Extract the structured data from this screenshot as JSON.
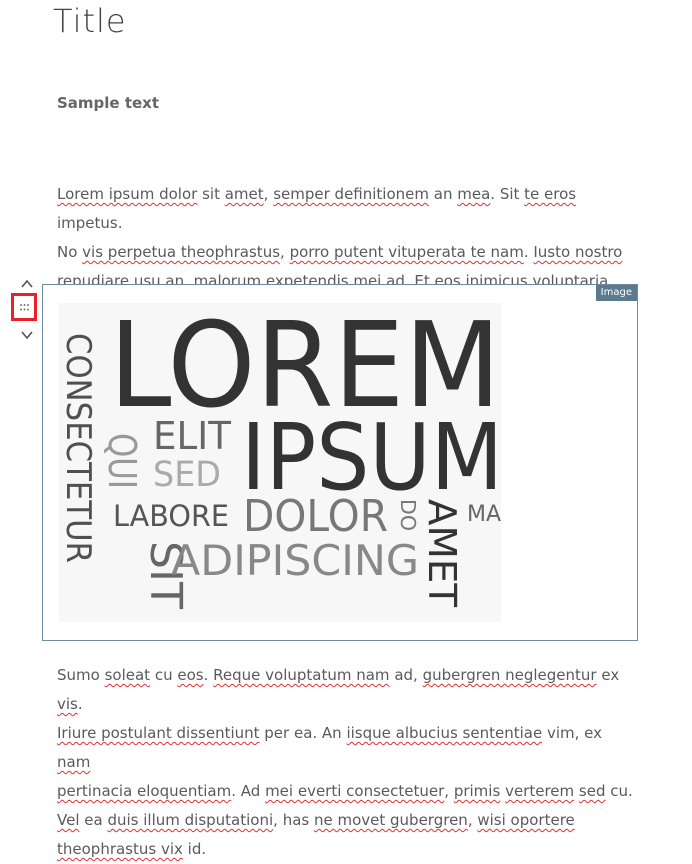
{
  "page": {
    "title": "Title",
    "subtitle": "Sample text"
  },
  "paragraph1": {
    "lines": [
      [
        "Lorem ipsum dolor",
        " sit ",
        "amet",
        ", ",
        "semper definitionem",
        " an ",
        "mea",
        ". Sit ",
        "te eros",
        " impetus."
      ],
      [
        "No ",
        "vis perpetua theophrastus",
        ", ",
        "porro putent vituperata te nam",
        ". ",
        "Iusto nostro"
      ],
      [
        "repudiare",
        " usu an, ",
        "malorum expetendis mei",
        " ad. ",
        "Et eos inimicus voluptaria",
        "."
      ]
    ]
  },
  "block_tools": {
    "move_up": "move-up",
    "drag": "drag-handle",
    "move_down": "move-down"
  },
  "image_block": {
    "badge": "Image",
    "words": [
      "LOREM",
      "IPSUM",
      "CONSECTETUR",
      "QUI",
      "ELIT",
      "SED",
      "LABORE",
      "DOLOR",
      "DO",
      "AMET",
      "MA",
      "SIT",
      "ADIPISCING"
    ]
  },
  "paragraph2": {
    "lines": [
      [
        "Sumo ",
        "soleat",
        " cu ",
        "eos",
        ". ",
        "Reque voluptatum nam",
        " ad, ",
        "gubergren neglegentur",
        " ex  ",
        "vis",
        "."
      ],
      [
        "Iriure postulant dissentiunt",
        " per ea. An ",
        "iisque albucius sententiae",
        "  vim, ex ",
        "nam"
      ],
      [
        "pertinacia eloquentiam",
        ". Ad ",
        "mei everti consectetuer",
        ", ",
        "primis",
        "  ",
        "verterem",
        " ",
        "sed",
        " cu."
      ],
      [
        "Vel",
        " ea ",
        "duis illum disputationi",
        ", has ",
        "ne movet gubergren",
        ",  ",
        "wisi oportere"
      ],
      [
        "theophrastus vix",
        " id."
      ]
    ]
  },
  "colors": {
    "accent": "#e8212a",
    "badge": "#5b7a90",
    "block_border": "#6d8ba3",
    "spellcheck": "#e03030"
  }
}
